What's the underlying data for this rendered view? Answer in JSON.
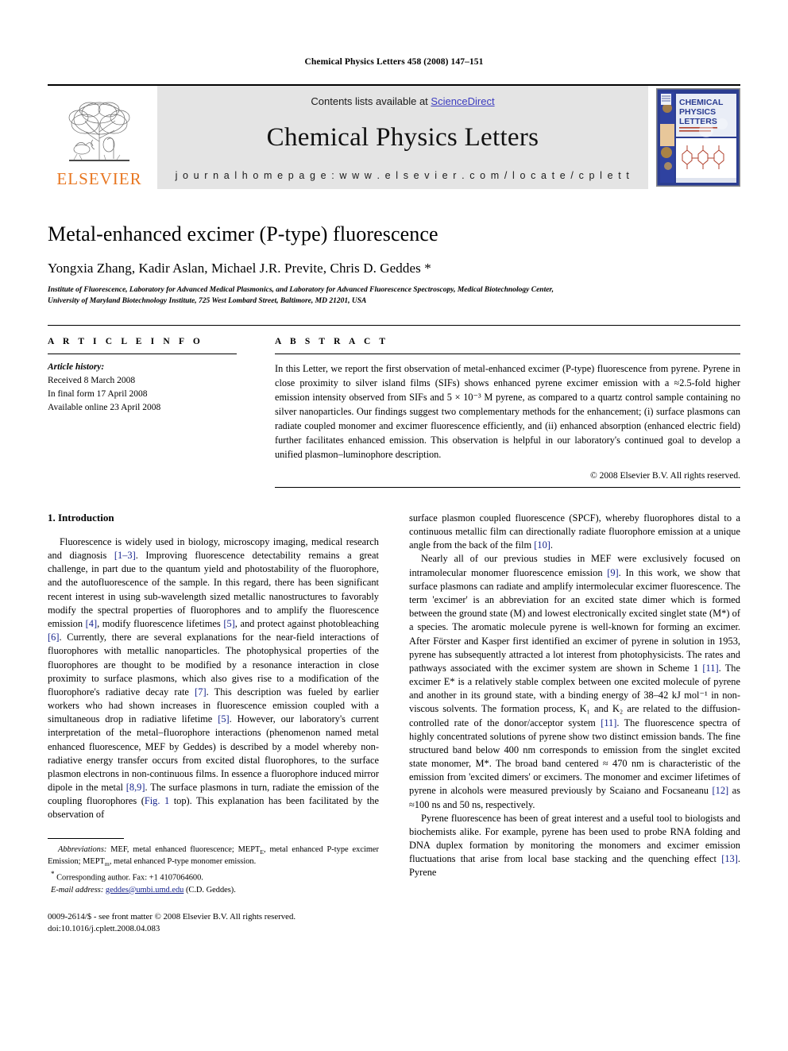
{
  "running_head": "Chemical Physics Letters 458 (2008) 147–151",
  "masthead": {
    "publisher_name": "ELSEVIER",
    "contents_prefix": "Contents lists available at ",
    "sciencedirect": "ScienceDirect",
    "journal_name": "Chemical Physics Letters",
    "homepage": "j o u r n a l   h o m e p a g e :   w w w . e l s e v i e r . c o m / l o c a t e / c p l e t t",
    "cover": {
      "line1": "CHEMICAL",
      "line2": "PHYSICS",
      "line3": "LETTERS"
    },
    "colors": {
      "sciencedirect_blue": "#3b3bbf",
      "elsevier_orange": "#E87722",
      "banner_grey": "#e4e4e4",
      "cover_blue": "#2b3d91"
    }
  },
  "title": "Metal-enhanced excimer (P-type) fluorescence",
  "authors": "Yongxia Zhang, Kadir Aslan, Michael J.R. Previte, Chris D. Geddes *",
  "affiliation_line1": "Institute of Fluorescence, Laboratory for Advanced Medical Plasmonics, and Laboratory for Advanced Fluorescence Spectroscopy, Medical Biotechnology Center,",
  "affiliation_line2": "University of Maryland Biotechnology Institute, 725 West Lombard Street, Baltimore, MD 21201, USA",
  "article_info": {
    "heading": "A R T I C L E   I N F O",
    "history_label": "Article history:",
    "received": "Received 8 March 2008",
    "final_form": "In final form 17 April 2008",
    "available_online": "Available online 23 April 2008"
  },
  "abstract": {
    "heading": "A B S T R A C T",
    "text": "In this Letter, we report the first observation of metal-enhanced excimer (P-type) fluorescence from pyrene. Pyrene in close proximity to silver island films (SIFs) shows enhanced pyrene excimer emission with a ≈2.5-fold higher emission intensity observed from SIFs and 5 × 10⁻³ M pyrene, as compared to a quartz control sample containing no silver nanoparticles. Our findings suggest two complementary methods for the enhancement; (i) surface plasmons can radiate coupled monomer and excimer fluorescence efficiently, and (ii) enhanced absorption (enhanced electric field) further facilitates enhanced emission. This observation is helpful in our laboratory's continued goal to develop a unified plasmon–luminophore description.",
    "copyright": "© 2008 Elsevier B.V. All rights reserved."
  },
  "left_column": {
    "section_number_title": "1. Introduction",
    "para1_a": "Fluorescence is widely used in biology, microscopy imaging, medical research and diagnosis ",
    "para1_ref1": "[1–3]",
    "para1_b": ". Improving fluorescence detectability remains a great challenge, in part due to the quantum yield and photostability of the fluorophore, and the autofluorescence of the sample. In this regard, there has been significant recent interest in using sub-wavelength sized metallic nanostructures to favorably modify the spectral properties of fluorophores and to amplify the fluorescence emission ",
    "para1_ref2": "[4]",
    "para1_c": ", modify fluorescence lifetimes ",
    "para1_ref3": "[5]",
    "para1_d": ", and protect against photobleaching ",
    "para1_ref4": "[6]",
    "para1_e": ". Currently, there are several explanations for the near-field interactions of fluorophores with metallic nanoparticles. The photophysical properties of the fluorophores are thought to be modified by a resonance interaction in close proximity to surface plasmons, which also gives rise to a modification of the fluorophore's radiative decay rate ",
    "para1_ref5": "[7]",
    "para1_f": ". This description was fueled by earlier workers who had shown increases in fluorescence emission coupled with a simultaneous drop in radiative lifetime ",
    "para1_ref6": "[5]",
    "para1_g": ". However, our laboratory's current interpretation of the metal–fluorophore interactions (phenomenon named metal enhanced fluorescence, MEF by Geddes) is described by a model whereby non-radiative energy transfer occurs from excited distal fluorophores, to the surface plasmon electrons in non-continuous films. In essence a fluorophore induced mirror dipole in the metal ",
    "para1_ref7": "[8,9]",
    "para1_h": ". The surface plasmons in turn, radiate the emission of the coupling fluorophores (",
    "para1_ref8": "Fig. 1",
    "para1_i": " top). This explanation has been facilitated by the observation of"
  },
  "right_column": {
    "para_cont_a": "surface plasmon coupled fluorescence (SPCF), whereby fluorophores distal to a continuous metallic film can directionally radiate fluorophore emission at a unique angle from the back of the film ",
    "para_cont_ref": "[10]",
    "para_cont_b": ".",
    "para2_a": "Nearly all of our previous studies in MEF were exclusively focused on intramolecular monomer fluorescence emission ",
    "para2_ref1": "[9]",
    "para2_b": ". In this work, we show that surface plasmons can radiate and amplify intermolecular excimer fluorescence. The term 'excimer' is an abbreviation for an excited state dimer which is formed between the ground state (M) and lowest electronically excited singlet state (M*) of a species. The aromatic molecule pyrene is well-known for forming an excimer. After Förster and Kasper first identified an excimer of pyrene in solution in 1953, pyrene has subsequently attracted a lot interest from photophysicists. The rates and pathways associated with the excimer system are shown in Scheme 1 ",
    "para2_ref2": "[11]",
    "para2_c": ". The excimer E* is a relatively stable complex between one excited molecule of pyrene and another in its ground state, with a binding energy of 38–42 kJ mol⁻¹ in non-viscous solvents. The formation process, K₁ and K₂ are related to the diffusion-controlled rate of the donor/acceptor system ",
    "para2_ref3": "[11]",
    "para2_d": ". The fluorescence spectra of highly concentrated solutions of pyrene show two distinct emission bands. The fine structured band below 400 nm corresponds to emission from the singlet excited state monomer, M*. The broad band centered ≈ 470 nm is characteristic of the emission from 'excited dimers' or excimers. The monomer and excimer lifetimes of pyrene in alcohols were measured previously by Scaiano and Focsaneanu ",
    "para2_ref4": "[12]",
    "para2_e": " as ≈100 ns and 50 ns, respectively.",
    "para3_a": "Pyrene fluorescence has been of great interest and a useful tool to biologists and biochemists alike. For example, pyrene has been used to probe RNA folding and DNA duplex formation by monitoring the monomers and excimer emission fluctuations that arise from local base stacking and the quenching effect ",
    "para3_ref1": "[13]",
    "para3_b": ". Pyrene"
  },
  "footnotes": {
    "abbrev_label": "Abbreviations:",
    "abbrev_text_a": " MEF, metal enhanced fluorescence; MEPT",
    "abbrev_sub_e": "E",
    "abbrev_text_b": ", metal enhanced P-type excimer Emission; MEPT",
    "abbrev_sub_m": "m",
    "abbrev_text_c": ", metal enhanced P-type monomer emission.",
    "corresponding": "Corresponding author. Fax: +1 4107064600.",
    "email_label": "E-mail address:",
    "email": "geddes@umbi.umd.edu",
    "email_suffix": " (C.D. Geddes).",
    "issn_line": "0009-2614/$ - see front matter © 2008 Elsevier B.V. All rights reserved.",
    "doi_line": "doi:10.1016/j.cplett.2008.04.083"
  }
}
